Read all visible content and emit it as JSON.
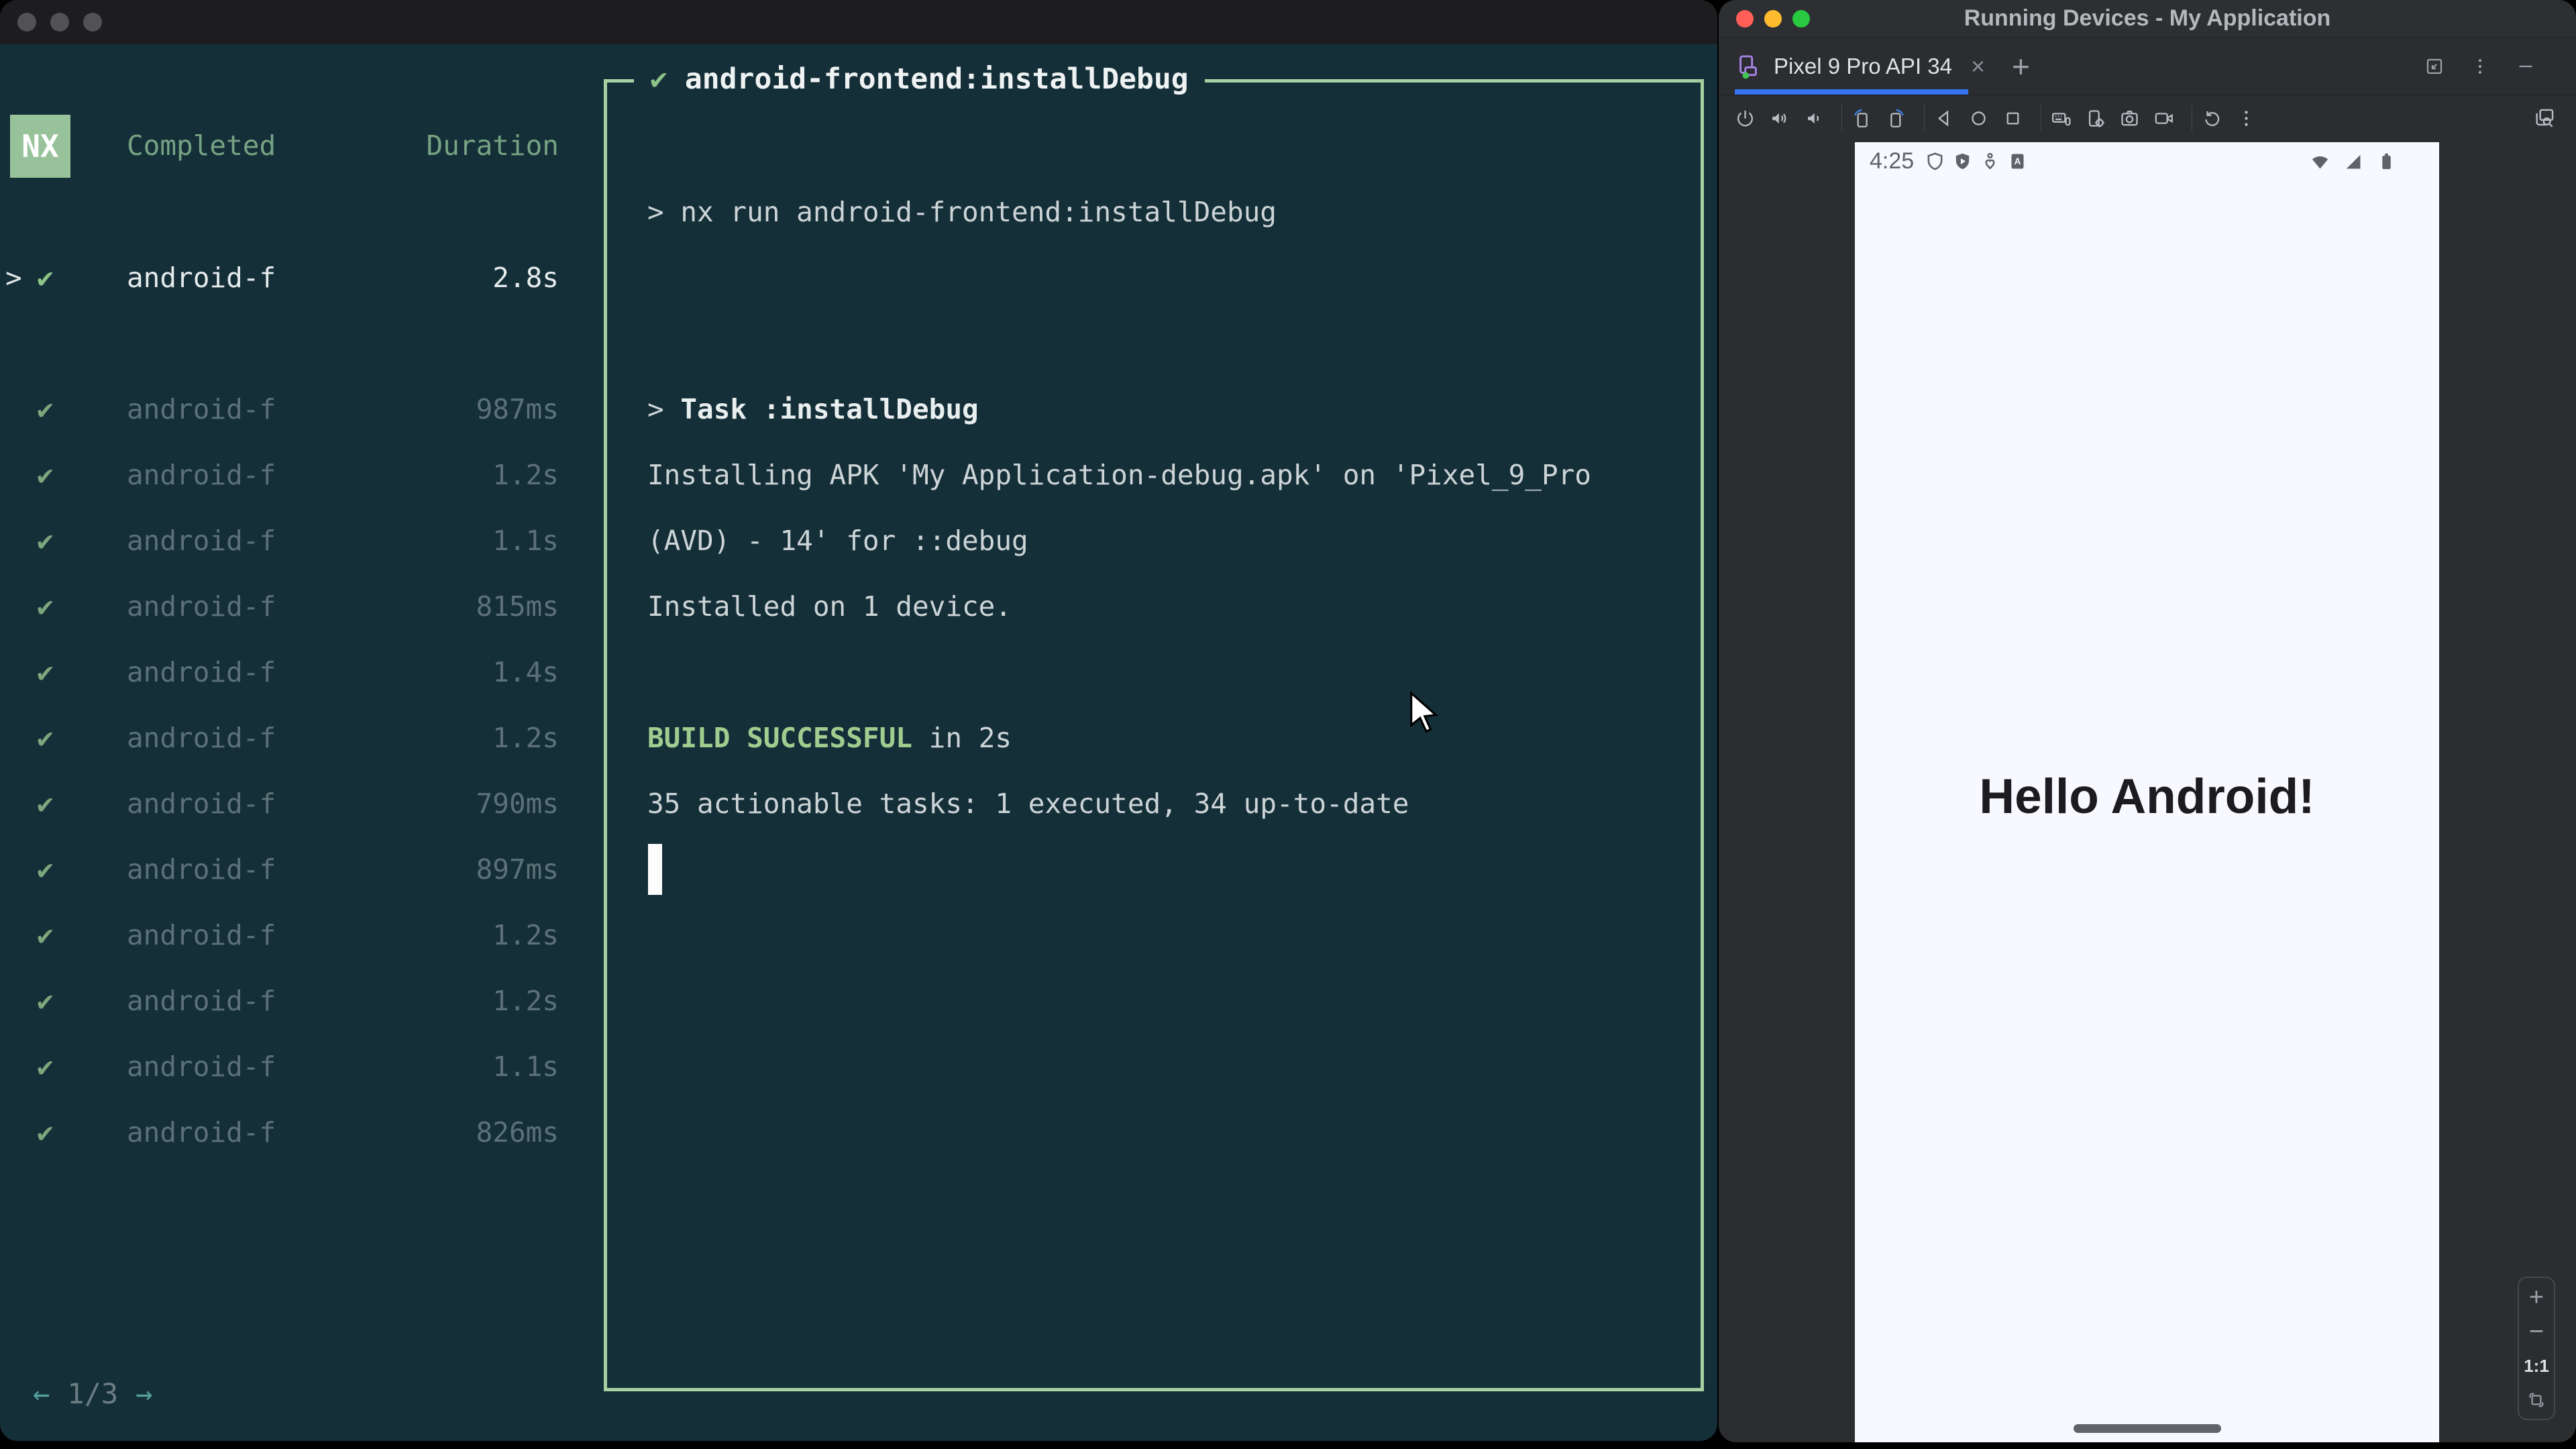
{
  "colors": {
    "terminal_bg": "#152f39",
    "nx_green": "#97c29a",
    "border_green": "#a7d0a0",
    "build_green": "#a0cd8f",
    "tab_blue": "#3574f0",
    "traffic_red": "#ff5f57",
    "traffic_yellow": "#febc2e",
    "traffic_green": "#28c840"
  },
  "terminal": {
    "logo": "NX",
    "columns": {
      "completed": "Completed",
      "duration": "Duration"
    },
    "selected_task": {
      "caret": ">",
      "check": "✔",
      "name": "android-f",
      "duration": "2.8s"
    },
    "tasks": [
      {
        "check": "✔",
        "name": "android-f",
        "duration": "987ms"
      },
      {
        "check": "✔",
        "name": "android-f",
        "duration": "1.2s"
      },
      {
        "check": "✔",
        "name": "android-f",
        "duration": "1.1s"
      },
      {
        "check": "✔",
        "name": "android-f",
        "duration": "815ms"
      },
      {
        "check": "✔",
        "name": "android-f",
        "duration": "1.4s"
      },
      {
        "check": "✔",
        "name": "android-f",
        "duration": "1.2s"
      },
      {
        "check": "✔",
        "name": "android-f",
        "duration": "790ms"
      },
      {
        "check": "✔",
        "name": "android-f",
        "duration": "897ms"
      },
      {
        "check": "✔",
        "name": "android-f",
        "duration": "1.2s"
      },
      {
        "check": "✔",
        "name": "android-f",
        "duration": "1.2s"
      },
      {
        "check": "✔",
        "name": "android-f",
        "duration": "1.1s"
      },
      {
        "check": "✔",
        "name": "android-f",
        "duration": "826ms"
      }
    ],
    "pagination": {
      "prev": "←",
      "label": "1/3",
      "next": "→"
    },
    "output": {
      "check": "✔",
      "title": "android-frontend:installDebug",
      "lines": [
        {
          "segments": [
            {
              "text": "> nx run android-frontend:installDebug",
              "style": "text"
            }
          ]
        },
        {
          "segments": []
        },
        {
          "segments": []
        },
        {
          "segments": [
            {
              "text": "> ",
              "style": "text"
            },
            {
              "text": "Task :installDebug",
              "style": "bold"
            }
          ]
        },
        {
          "segments": [
            {
              "text": "Installing APK 'My Application-debug.apk' on 'Pixel_9_Pro",
              "style": "text"
            }
          ]
        },
        {
          "segments": [
            {
              "text": "(AVD) - 14' for ::debug",
              "style": "text"
            }
          ]
        },
        {
          "segments": [
            {
              "text": "Installed on 1 device.",
              "style": "text"
            }
          ]
        },
        {
          "segments": []
        },
        {
          "segments": [
            {
              "text": "BUILD SUCCESSFUL",
              "style": "green-bold"
            },
            {
              "text": " in 2s",
              "style": "text"
            }
          ]
        },
        {
          "segments": [
            {
              "text": "35 actionable tasks: 1 executed, 34 up-to-date",
              "style": "text"
            }
          ]
        }
      ]
    }
  },
  "studio": {
    "title": "Running Devices - My Application",
    "tab": {
      "device_icon": "phone-device-icon",
      "label": "Pixel 9 Pro API 34",
      "close_glyph": "×",
      "new_tab_glyph": "+"
    },
    "window_controls": [
      "float-window-icon",
      "more-vert-icon",
      "hide-icon"
    ],
    "toolbar_icons": [
      "power-icon",
      "volume-up-icon",
      "volume-down-icon",
      "rotate-left-icon",
      "rotate-right-icon",
      "back-icon",
      "home-icon",
      "recents-icon",
      "hardware-input-icon",
      "device-settings-icon",
      "screenshot-icon",
      "screen-record-icon",
      "restart-icon",
      "more-icon"
    ],
    "snapshots_icon": "device-snapshots-icon",
    "emulator": {
      "time": "4:25",
      "status_icons": [
        "shield-icon",
        "shield-play-icon",
        "wellbeing-icon",
        "auto-fill-icon"
      ],
      "status_icons_right": [
        "wifi-icon",
        "cellular-icon",
        "battery-icon"
      ],
      "hello": "Hello Android!",
      "zoom": {
        "in": "+",
        "out": "−",
        "actual": "1:1",
        "fit": "fit-screen-icon"
      }
    }
  }
}
